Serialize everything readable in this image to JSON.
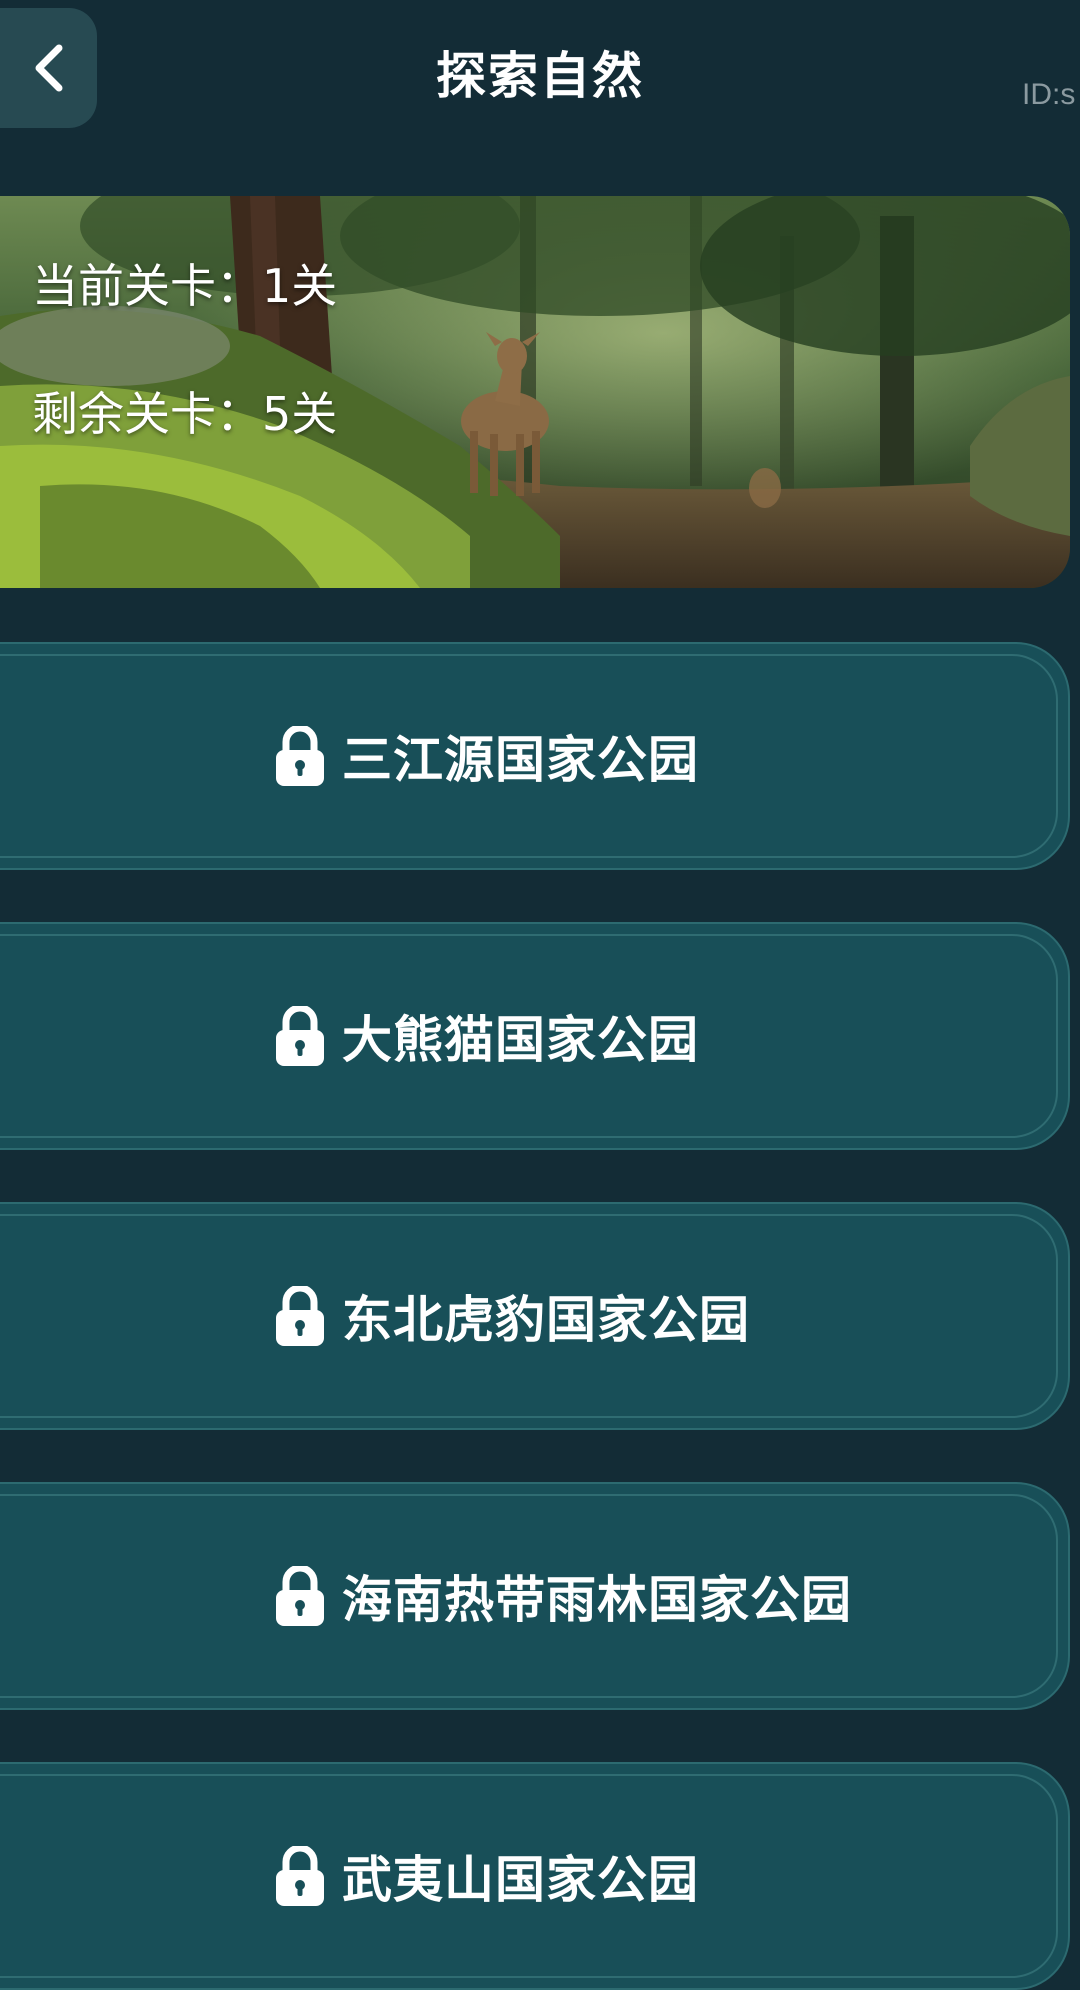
{
  "header": {
    "title": "探索自然",
    "user_id": "ID:s",
    "back_icon": "chevron-left-icon"
  },
  "banner": {
    "current_level": "当前关卡：1关",
    "remaining_levels": "剩余关卡：5关"
  },
  "levels": [
    {
      "name": "三江源国家公园",
      "icon": "lock-icon",
      "locked": true
    },
    {
      "name": "大熊猫国家公园",
      "icon": "lock-icon",
      "locked": true
    },
    {
      "name": "东北虎豹国家公园",
      "icon": "lock-icon",
      "locked": true
    },
    {
      "name": "海南热带雨林国家公园",
      "icon": "lock-icon",
      "locked": true
    },
    {
      "name": "武夷山国家公园",
      "icon": "lock-icon",
      "locked": true
    }
  ],
  "colors": {
    "background": "#132c36",
    "card": "#184f58",
    "card_border": "#2c6a70",
    "back_button": "#274a52",
    "text": "#ffffff"
  }
}
